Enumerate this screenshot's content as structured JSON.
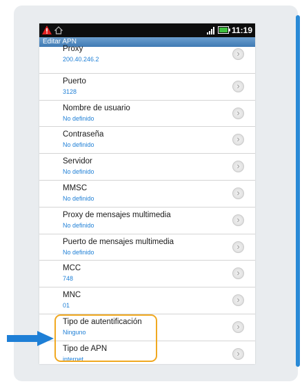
{
  "status_bar": {
    "time": "11:19"
  },
  "header": {
    "title": "Editar APN"
  },
  "rows": [
    {
      "title": "Proxy",
      "value": "200.40.246.2"
    },
    {
      "title": "Puerto",
      "value": "3128"
    },
    {
      "title": "Nombre de usuario",
      "value": "No definido"
    },
    {
      "title": "Contraseña",
      "value": "No definido"
    },
    {
      "title": "Servidor",
      "value": "No definido"
    },
    {
      "title": "MMSC",
      "value": "No definido"
    },
    {
      "title": "Proxy de mensajes multimedia",
      "value": "No definido"
    },
    {
      "title": "Puerto de mensajes multimedia",
      "value": "No definido"
    },
    {
      "title": "MCC",
      "value": "748"
    },
    {
      "title": "MNC",
      "value": "01"
    },
    {
      "title": "Tipo de autentificación",
      "value": "Ninguno"
    },
    {
      "title": "Tipo de APN",
      "value": "internet"
    }
  ],
  "colors": {
    "accent": "#1e7fd6",
    "highlight": "#f0a820",
    "arrow": "#1e7fd6",
    "titlebar": "#4f88c0"
  },
  "icons": [
    "warning-icon",
    "home-icon",
    "signal-icon",
    "battery-icon",
    "chevron-right-icon",
    "pointer-arrow-icon"
  ]
}
